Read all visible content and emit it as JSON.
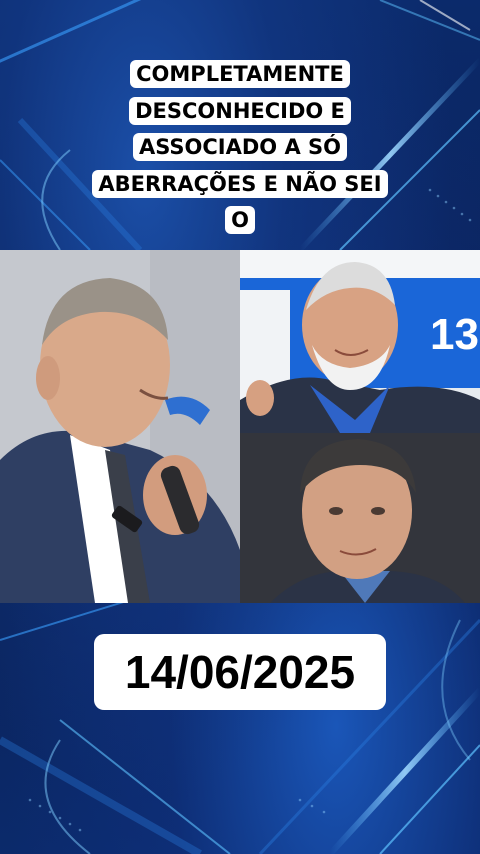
{
  "caption": {
    "lines": [
      "COMPLETAMENTE",
      "DESCONHECIDO E",
      "ASSOCIADO A SÓ",
      "ABERRAÇÕES E NÃO SEI",
      "O"
    ]
  },
  "photos": {
    "right_top_banner_text": "13"
  },
  "date": "14/06/2025",
  "colors": {
    "background": "#0a1f52",
    "accent": "#2f8bff",
    "badge": "#ffffff",
    "text": "#000000"
  }
}
